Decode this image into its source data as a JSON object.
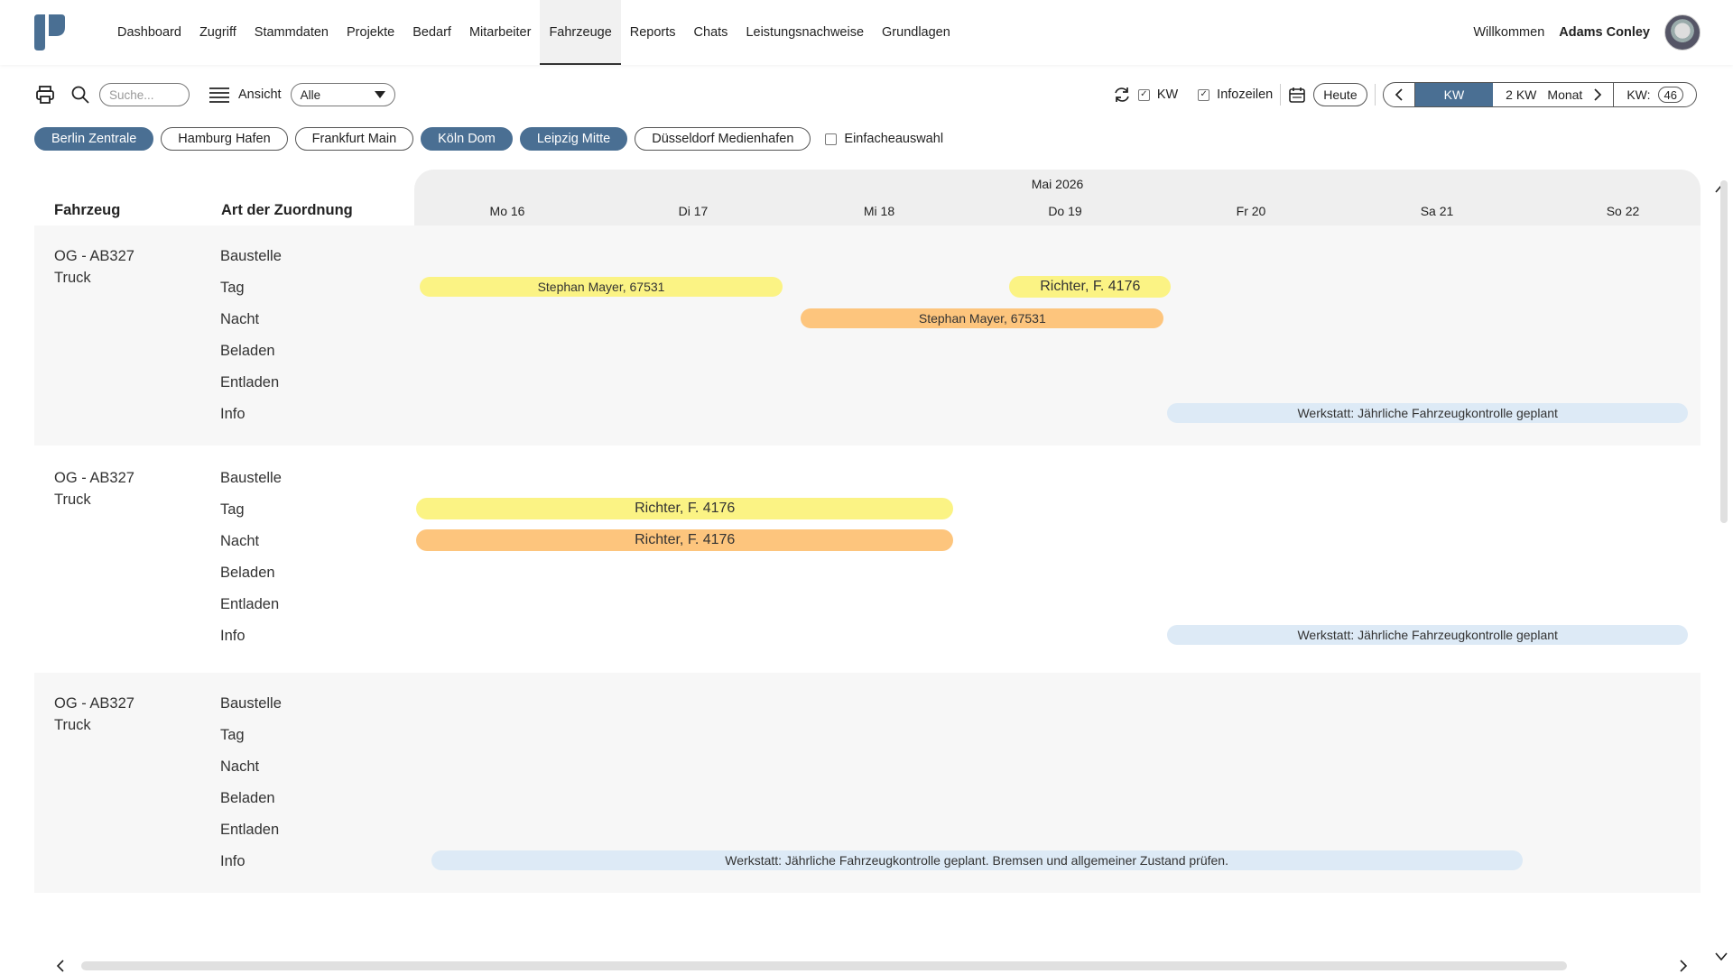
{
  "nav": {
    "items": [
      {
        "label": "Dashboard",
        "active": false
      },
      {
        "label": "Zugriff",
        "active": false
      },
      {
        "label": "Stammdaten",
        "active": false
      },
      {
        "label": "Projekte",
        "active": false
      },
      {
        "label": "Bedarf",
        "active": false
      },
      {
        "label": "Mitarbeiter",
        "active": false
      },
      {
        "label": "Fahrzeuge",
        "active": true
      },
      {
        "label": "Reports",
        "active": false
      },
      {
        "label": "Chats",
        "active": false
      },
      {
        "label": "Leistungsnachweise",
        "active": false
      },
      {
        "label": "Grundlagen",
        "active": false
      }
    ],
    "welcome": "Willkommen",
    "user_name": "Adams Conley"
  },
  "toolbar": {
    "search_placeholder": "Suche...",
    "ansicht_label": "Ansicht",
    "ansicht_value": "Alle",
    "kw_check_label": "KW",
    "kw_checked": true,
    "infozeilen_label": "Infozeilen",
    "infozeilen_checked": true,
    "heute_label": "Heute",
    "period_kw": "KW",
    "period_2kw": "2 KW",
    "period_monat": "Monat",
    "kw_label": "KW:",
    "kw_value": "46"
  },
  "filters": {
    "chips": [
      {
        "label": "Berlin Zentrale",
        "selected": true
      },
      {
        "label": "Hamburg Hafen",
        "selected": false
      },
      {
        "label": "Frankfurt Main",
        "selected": false
      },
      {
        "label": "Köln Dom",
        "selected": true
      },
      {
        "label": "Leipzig Mitte",
        "selected": true
      },
      {
        "label": "Düsseldorf Medienhafen",
        "selected": false
      }
    ],
    "single_select_label": "Einfacheauswahl",
    "single_select_checked": false
  },
  "grid": {
    "col_vehicle": "Fahrzeug",
    "col_assignment": "Art der Zuordnung",
    "month": "Mai 2026",
    "days": [
      "Mo  16",
      "Di  17",
      "Mi  18",
      "Do  19",
      "Fr  20",
      "Sa  21",
      "So  22"
    ],
    "row_labels": [
      "Baustelle",
      "Tag",
      "Nacht",
      "Beladen",
      "Entladen",
      "Info"
    ]
  },
  "vehicles": [
    {
      "plate": "OG - AB327",
      "type": "Truck",
      "bars": [
        {
          "text": "Stephan Mayer, 67531",
          "row": "Tag",
          "color": "yellow",
          "start_day": 0.03,
          "end_day": 1.98
        },
        {
          "text": "Richter, F. 4176",
          "row": "Tag",
          "color": "yellow",
          "start_day": 3.2,
          "end_day": 4.07
        },
        {
          "text": "Stephan Mayer, 67531",
          "row": "Nacht",
          "color": "orange",
          "start_day": 2.08,
          "end_day": 4.03
        },
        {
          "text": "Werkstatt: Jährliche Fahrzeugkontrolle geplant",
          "row": "Info",
          "color": "blue",
          "start_day": 4.05,
          "end_day": 6.85
        }
      ]
    },
    {
      "plate": "OG - AB327",
      "type": "Truck",
      "bars": [
        {
          "text": "Richter, F. 4176",
          "row": "Tag",
          "color": "yellow",
          "start_day": 0.01,
          "end_day": 2.9
        },
        {
          "text": "Richter, F. 4176",
          "row": "Nacht",
          "color": "orange",
          "start_day": 0.01,
          "end_day": 2.9
        },
        {
          "text": "Werkstatt: Jährliche Fahrzeugkontrolle geplant",
          "row": "Info",
          "color": "blue",
          "start_day": 4.05,
          "end_day": 6.85
        }
      ]
    },
    {
      "plate": "OG - AB327",
      "type": "Truck",
      "bars": [
        {
          "text": "Werkstatt: Jährliche Fahrzeugkontrolle geplant. Bremsen und allgemeiner Zustand prüfen.",
          "row": "Info",
          "color": "blue",
          "start_day": 0.09,
          "end_day": 5.96
        }
      ]
    }
  ],
  "colors": {
    "accent": "#4a6f93",
    "bar_yellow": "#fbf384",
    "bar_orange": "#fdc57d",
    "bar_blue": "#ddeaf6"
  }
}
